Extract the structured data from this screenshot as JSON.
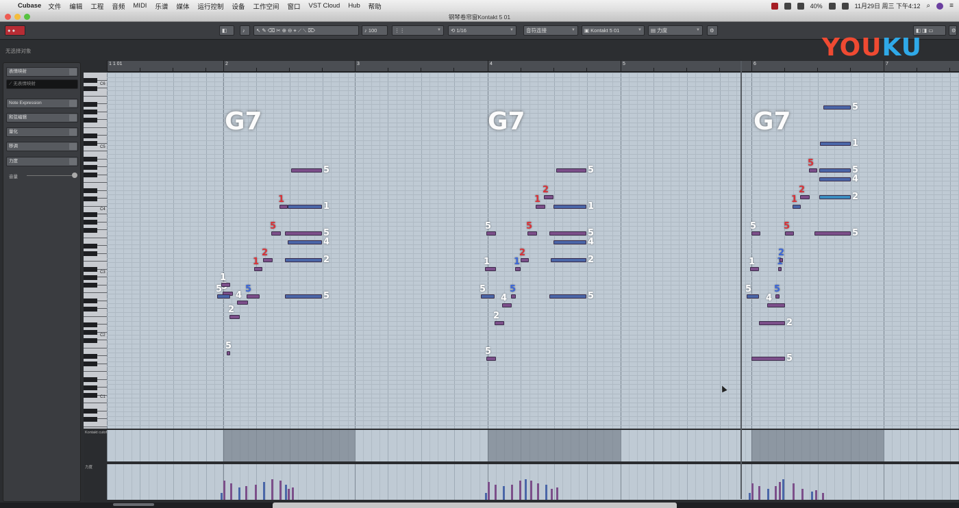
{
  "menubar": {
    "app": "Cubase",
    "items": [
      "文件",
      "编辑",
      "工程",
      "音频",
      "MIDI",
      "乐谱",
      "媒体",
      "运行控制",
      "设备",
      "工作空间",
      "窗口",
      "VST Cloud",
      "Hub",
      "帮助"
    ],
    "battery": "40%",
    "clock": "11月29日 周三 下午4:12"
  },
  "window": {
    "title": "钢琴卷帘窗Kontakt 5 01"
  },
  "toolbar": {
    "quantize": "1/16",
    "length": "1/16",
    "insert_velocity": "100",
    "chord_mode": "音符连接",
    "instrument": "Kontakt 5 01",
    "lane_mode": "力度"
  },
  "infoline": {
    "label": "无选择对象"
  },
  "logo": {
    "part1": "YOU",
    "part2": "KU"
  },
  "inspector": {
    "items": [
      "表情映射",
      "无表情映射",
      "Note Expression",
      "和弦编辑",
      "量化",
      "移调",
      "力度"
    ],
    "volume_label": "音量"
  },
  "ruler": {
    "labels": [
      "1 1 01",
      "2",
      "3",
      "4",
      "5",
      "6",
      "7"
    ]
  },
  "keys": {
    "labels": [
      "C6",
      "C5",
      "C4",
      "C3",
      "C2",
      "C1"
    ]
  },
  "lanes": {
    "labels": [
      "Kontakt cutoff",
      "力度"
    ]
  },
  "chords": [
    "G7",
    "G7",
    "G7"
  ],
  "notes": [
    [
      325,
      429,
      340,
      0,
      "p",
      "5",
      "w"
    ],
    [
      331,
      516,
      336,
      0,
      "p",
      "5",
      "w"
    ],
    [
      323,
      416,
      336,
      0,
      "p",
      "1",
      "w"
    ],
    [
      317,
      433,
      336,
      0,
      "b",
      "5",
      "w"
    ],
    [
      346,
      442,
      362,
      0,
      "p",
      "4",
      "w"
    ],
    [
      335,
      463,
      350,
      0,
      "p",
      "2",
      "w"
    ],
    [
      360,
      433,
      379,
      0,
      "p",
      "5",
      "b"
    ],
    [
      371,
      393,
      383,
      0,
      "p",
      "1",
      "r"
    ],
    [
      384,
      380,
      398,
      0,
      "p",
      "2",
      "r"
    ],
    [
      396,
      341,
      410,
      0,
      "p",
      "5",
      "r"
    ],
    [
      408,
      302,
      420,
      0,
      "p",
      "1",
      "r"
    ],
    [
      416,
      433,
      470,
      0,
      "b",
      "5",
      "w"
    ],
    [
      416,
      380,
      470,
      0,
      "b",
      "2",
      "w"
    ],
    [
      420,
      354,
      470,
      0,
      "b",
      "4",
      "w"
    ],
    [
      416,
      341,
      470,
      0,
      "p",
      "5",
      "w"
    ],
    [
      420,
      302,
      470,
      0,
      "b",
      "1",
      "w"
    ],
    [
      425,
      249,
      470,
      0,
      "p",
      "5",
      "w"
    ],
    [
      710,
      524,
      724,
      0,
      "p",
      "5",
      "w"
    ],
    [
      710,
      341,
      724,
      0,
      "p",
      "5",
      "w"
    ],
    [
      708,
      393,
      724,
      0,
      "p",
      "1",
      "w"
    ],
    [
      702,
      433,
      722,
      0,
      "b",
      "5",
      "w"
    ],
    [
      733,
      446,
      747,
      0,
      "p",
      "4",
      "w"
    ],
    [
      722,
      472,
      736,
      0,
      "p",
      "2",
      "w"
    ],
    [
      746,
      433,
      753,
      0,
      "p",
      "5",
      "b"
    ],
    [
      752,
      393,
      760,
      0,
      "p",
      "1",
      "b"
    ],
    [
      760,
      380,
      772,
      0,
      "p",
      "2",
      "r"
    ],
    [
      770,
      341,
      784,
      0,
      "p",
      "5",
      "r"
    ],
    [
      782,
      302,
      796,
      0,
      "p",
      "1",
      "r"
    ],
    [
      794,
      288,
      808,
      0,
      "p",
      "2",
      "r"
    ],
    [
      802,
      433,
      856,
      0,
      "b",
      "5",
      "w"
    ],
    [
      804,
      380,
      856,
      0,
      "b",
      "2",
      "w"
    ],
    [
      808,
      354,
      856,
      0,
      "b",
      "4",
      "w"
    ],
    [
      802,
      341,
      856,
      0,
      "p",
      "5",
      "w"
    ],
    [
      808,
      302,
      856,
      0,
      "b",
      "1",
      "w"
    ],
    [
      812,
      249,
      856,
      0,
      "p",
      "5",
      "w"
    ],
    [
      1097,
      524,
      1146,
      0,
      "p",
      "5",
      "w"
    ],
    [
      1097,
      341,
      1110,
      0,
      "p",
      "5",
      "w"
    ],
    [
      1095,
      393,
      1108,
      0,
      "p",
      "1",
      "w"
    ],
    [
      1090,
      433,
      1108,
      0,
      "b",
      "5",
      "w"
    ],
    [
      1120,
      446,
      1146,
      0,
      "p",
      "4",
      "w"
    ],
    [
      1108,
      472,
      1146,
      0,
      "p",
      "2",
      "w"
    ],
    [
      1132,
      433,
      1138,
      0,
      "p",
      "5",
      "b"
    ],
    [
      1136,
      393,
      1141,
      0,
      "p",
      "1",
      "b"
    ],
    [
      1138,
      380,
      1143,
      0,
      "p",
      "2",
      "b"
    ],
    [
      1146,
      341,
      1159,
      0,
      "p",
      "5",
      "r"
    ],
    [
      1157,
      302,
      1169,
      0,
      "b",
      "1",
      "r"
    ],
    [
      1168,
      288,
      1182,
      0,
      "p",
      "2",
      "r"
    ],
    [
      1181,
      249,
      1193,
      0,
      "p",
      "5",
      "r"
    ],
    [
      1189,
      341,
      1242,
      0,
      "p",
      "5",
      "w"
    ],
    [
      1196,
      288,
      1242,
      0,
      "c",
      "2",
      "w"
    ],
    [
      1196,
      262,
      1242,
      0,
      "b",
      "4",
      "w"
    ],
    [
      1196,
      249,
      1242,
      0,
      "b",
      "5",
      "w"
    ],
    [
      1197,
      210,
      1242,
      0,
      "b",
      "1",
      "w"
    ],
    [
      1202,
      157,
      1242,
      0,
      "b",
      "5",
      "w"
    ]
  ],
  "colors": {
    "note_purple": "#7c4f8a",
    "note_blue": "#4a66a8",
    "note_cyan": "#3a8dc0",
    "finger_red": "#d8343a",
    "finger_blue": "#3d67d8",
    "finger_white": "#ffffff",
    "roll_bg": "#bfcad4",
    "record_red": "#b72c34"
  }
}
